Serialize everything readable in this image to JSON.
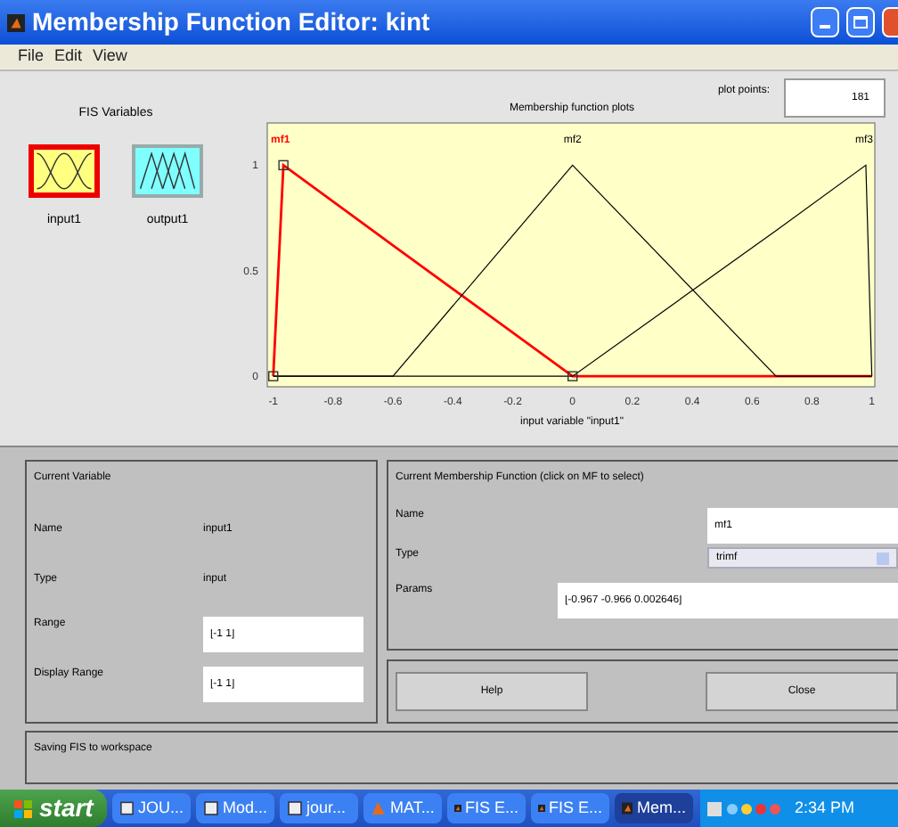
{
  "window": {
    "title": "Membership Function Editor: kint"
  },
  "menu": [
    "File",
    "Edit",
    "View"
  ],
  "fis_variables": {
    "title": "FIS Variables",
    "items": [
      {
        "label": "input1",
        "kind": "input",
        "selected": true
      },
      {
        "label": "output1",
        "kind": "output",
        "selected": false
      }
    ]
  },
  "plot_points": {
    "label": "plot points:",
    "value": "181"
  },
  "chart_data": {
    "type": "line",
    "title": "Membership function plots",
    "xlabel": "input variable \"input1\"",
    "x": [
      -1,
      -0.966,
      -0.6,
      0,
      0.68,
      0.98,
      1
    ],
    "series": [
      {
        "name": "mf1",
        "color": "#ff0000",
        "values": [
          0,
          1,
          0.62,
          0,
          0,
          0,
          0
        ]
      },
      {
        "name": "mf2",
        "color": "#000000",
        "values": [
          0,
          0,
          0,
          1,
          0,
          0,
          0
        ]
      },
      {
        "name": "mf3",
        "color": "#000000",
        "values": [
          0,
          0,
          0,
          0,
          0.69,
          1,
          0
        ]
      }
    ],
    "xlim": [
      -1.02,
      1.01
    ],
    "ylim": [
      -0.05,
      1.2
    ],
    "xticks": [
      -1,
      -0.8,
      -0.6,
      -0.4,
      -0.2,
      0,
      0.2,
      0.4,
      0.6,
      0.8,
      1
    ],
    "yticks": [
      0,
      0.5,
      1
    ]
  },
  "current_variable": {
    "title": "Current Variable",
    "name_label": "Name",
    "name": "input1",
    "type_label": "Type",
    "type": "input",
    "range_label": "Range",
    "range": "[-1 1]",
    "display_range_label": "Display Range",
    "display_range": "[-1 1]"
  },
  "current_mf": {
    "title": "Current Membership Function (click on MF to select)",
    "name_label": "Name",
    "name": "mf1",
    "type_label": "Type",
    "type": "trimf",
    "params_label": "Params",
    "params": "[-0.967 -0.966 0.002646]"
  },
  "buttons": [
    "Help",
    "Close"
  ],
  "status": "Saving FIS to workspace",
  "taskbar": {
    "start": "start",
    "items": [
      {
        "label": "JOU...",
        "kind": "doc",
        "selected": false
      },
      {
        "label": "Mod...",
        "kind": "doc",
        "selected": false
      },
      {
        "label": "jour...",
        "kind": "doc",
        "selected": false
      },
      {
        "label": "MAT...",
        "kind": "matlab",
        "selected": false
      },
      {
        "label": "FIS E...",
        "kind": "fis",
        "selected": false
      },
      {
        "label": "FIS E...",
        "kind": "fis",
        "selected": false
      },
      {
        "label": "Mem...",
        "kind": "fis",
        "selected": true
      }
    ],
    "clock": "2:34 PM"
  }
}
